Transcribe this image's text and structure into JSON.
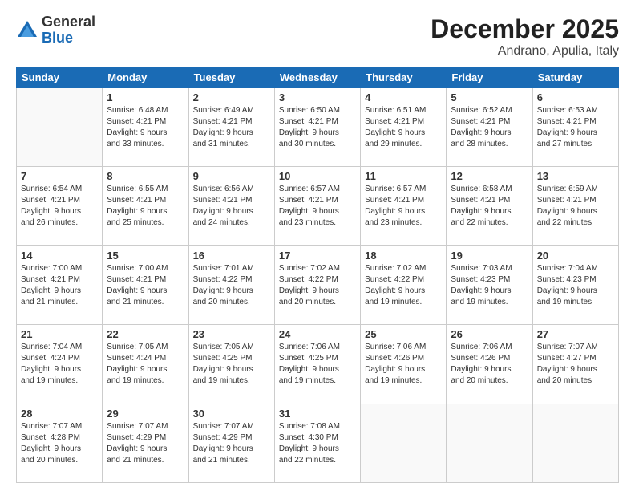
{
  "logo": {
    "general": "General",
    "blue": "Blue"
  },
  "header": {
    "title": "December 2025",
    "subtitle": "Andrano, Apulia, Italy"
  },
  "weekdays": [
    "Sunday",
    "Monday",
    "Tuesday",
    "Wednesday",
    "Thursday",
    "Friday",
    "Saturday"
  ],
  "weeks": [
    [
      {
        "day": "",
        "info": ""
      },
      {
        "day": "1",
        "info": "Sunrise: 6:48 AM\nSunset: 4:21 PM\nDaylight: 9 hours\nand 33 minutes."
      },
      {
        "day": "2",
        "info": "Sunrise: 6:49 AM\nSunset: 4:21 PM\nDaylight: 9 hours\nand 31 minutes."
      },
      {
        "day": "3",
        "info": "Sunrise: 6:50 AM\nSunset: 4:21 PM\nDaylight: 9 hours\nand 30 minutes."
      },
      {
        "day": "4",
        "info": "Sunrise: 6:51 AM\nSunset: 4:21 PM\nDaylight: 9 hours\nand 29 minutes."
      },
      {
        "day": "5",
        "info": "Sunrise: 6:52 AM\nSunset: 4:21 PM\nDaylight: 9 hours\nand 28 minutes."
      },
      {
        "day": "6",
        "info": "Sunrise: 6:53 AM\nSunset: 4:21 PM\nDaylight: 9 hours\nand 27 minutes."
      }
    ],
    [
      {
        "day": "7",
        "info": "Sunrise: 6:54 AM\nSunset: 4:21 PM\nDaylight: 9 hours\nand 26 minutes."
      },
      {
        "day": "8",
        "info": "Sunrise: 6:55 AM\nSunset: 4:21 PM\nDaylight: 9 hours\nand 25 minutes."
      },
      {
        "day": "9",
        "info": "Sunrise: 6:56 AM\nSunset: 4:21 PM\nDaylight: 9 hours\nand 24 minutes."
      },
      {
        "day": "10",
        "info": "Sunrise: 6:57 AM\nSunset: 4:21 PM\nDaylight: 9 hours\nand 23 minutes."
      },
      {
        "day": "11",
        "info": "Sunrise: 6:57 AM\nSunset: 4:21 PM\nDaylight: 9 hours\nand 23 minutes."
      },
      {
        "day": "12",
        "info": "Sunrise: 6:58 AM\nSunset: 4:21 PM\nDaylight: 9 hours\nand 22 minutes."
      },
      {
        "day": "13",
        "info": "Sunrise: 6:59 AM\nSunset: 4:21 PM\nDaylight: 9 hours\nand 22 minutes."
      }
    ],
    [
      {
        "day": "14",
        "info": "Sunrise: 7:00 AM\nSunset: 4:21 PM\nDaylight: 9 hours\nand 21 minutes."
      },
      {
        "day": "15",
        "info": "Sunrise: 7:00 AM\nSunset: 4:21 PM\nDaylight: 9 hours\nand 21 minutes."
      },
      {
        "day": "16",
        "info": "Sunrise: 7:01 AM\nSunset: 4:22 PM\nDaylight: 9 hours\nand 20 minutes."
      },
      {
        "day": "17",
        "info": "Sunrise: 7:02 AM\nSunset: 4:22 PM\nDaylight: 9 hours\nand 20 minutes."
      },
      {
        "day": "18",
        "info": "Sunrise: 7:02 AM\nSunset: 4:22 PM\nDaylight: 9 hours\nand 19 minutes."
      },
      {
        "day": "19",
        "info": "Sunrise: 7:03 AM\nSunset: 4:23 PM\nDaylight: 9 hours\nand 19 minutes."
      },
      {
        "day": "20",
        "info": "Sunrise: 7:04 AM\nSunset: 4:23 PM\nDaylight: 9 hours\nand 19 minutes."
      }
    ],
    [
      {
        "day": "21",
        "info": "Sunrise: 7:04 AM\nSunset: 4:24 PM\nDaylight: 9 hours\nand 19 minutes."
      },
      {
        "day": "22",
        "info": "Sunrise: 7:05 AM\nSunset: 4:24 PM\nDaylight: 9 hours\nand 19 minutes."
      },
      {
        "day": "23",
        "info": "Sunrise: 7:05 AM\nSunset: 4:25 PM\nDaylight: 9 hours\nand 19 minutes."
      },
      {
        "day": "24",
        "info": "Sunrise: 7:06 AM\nSunset: 4:25 PM\nDaylight: 9 hours\nand 19 minutes."
      },
      {
        "day": "25",
        "info": "Sunrise: 7:06 AM\nSunset: 4:26 PM\nDaylight: 9 hours\nand 19 minutes."
      },
      {
        "day": "26",
        "info": "Sunrise: 7:06 AM\nSunset: 4:26 PM\nDaylight: 9 hours\nand 20 minutes."
      },
      {
        "day": "27",
        "info": "Sunrise: 7:07 AM\nSunset: 4:27 PM\nDaylight: 9 hours\nand 20 minutes."
      }
    ],
    [
      {
        "day": "28",
        "info": "Sunrise: 7:07 AM\nSunset: 4:28 PM\nDaylight: 9 hours\nand 20 minutes."
      },
      {
        "day": "29",
        "info": "Sunrise: 7:07 AM\nSunset: 4:29 PM\nDaylight: 9 hours\nand 21 minutes."
      },
      {
        "day": "30",
        "info": "Sunrise: 7:07 AM\nSunset: 4:29 PM\nDaylight: 9 hours\nand 21 minutes."
      },
      {
        "day": "31",
        "info": "Sunrise: 7:08 AM\nSunset: 4:30 PM\nDaylight: 9 hours\nand 22 minutes."
      },
      {
        "day": "",
        "info": ""
      },
      {
        "day": "",
        "info": ""
      },
      {
        "day": "",
        "info": ""
      }
    ]
  ]
}
